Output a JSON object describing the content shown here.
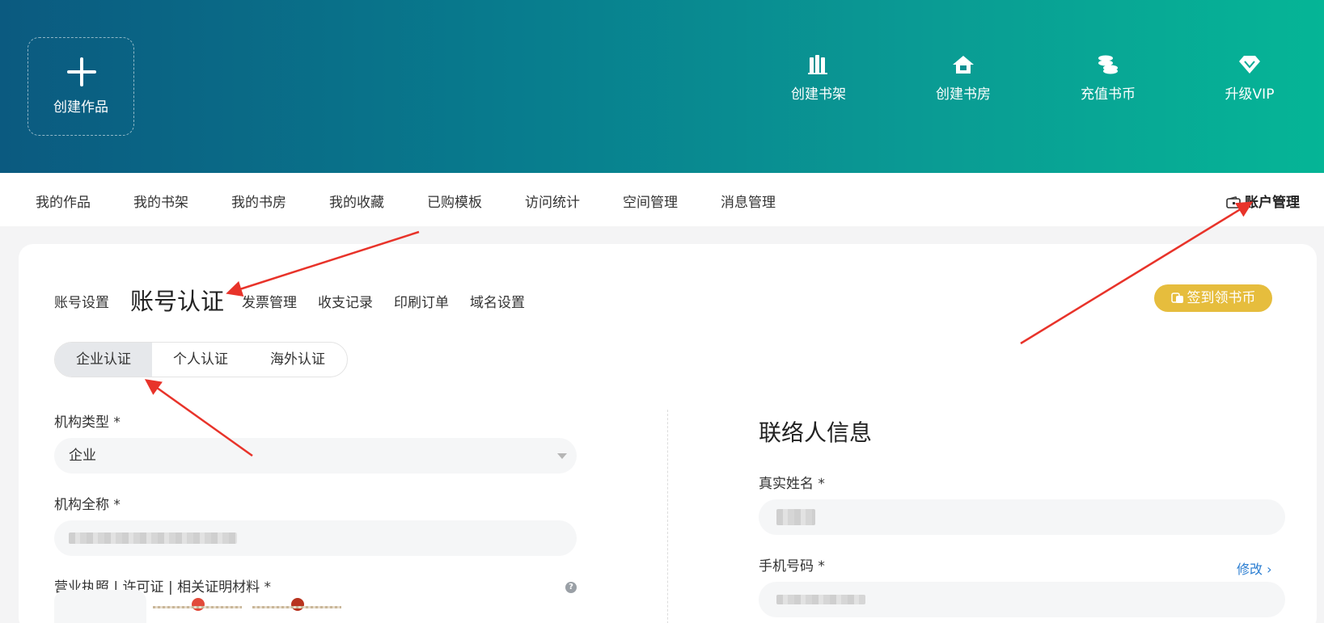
{
  "header": {
    "create_work": "创建作品",
    "actions": [
      {
        "label": "创建书架",
        "icon": "bookshelf-icon"
      },
      {
        "label": "创建书房",
        "icon": "house-icon"
      },
      {
        "label": "充值书币",
        "icon": "coins-icon"
      },
      {
        "label": "升级VIP",
        "icon": "diamond-icon"
      }
    ]
  },
  "nav": {
    "items": [
      "我的作品",
      "我的书架",
      "我的书房",
      "我的收藏",
      "已购模板",
      "访问统计",
      "空间管理",
      "消息管理"
    ],
    "account": "账户管理"
  },
  "subtabs": {
    "items": [
      "账号设置",
      "账号认证",
      "发票管理",
      "收支记录",
      "印刷订单",
      "域名设置"
    ],
    "active": "账号认证"
  },
  "checkin": {
    "label": "签到领书币"
  },
  "cert_types": {
    "items": [
      "企业认证",
      "个人认证",
      "海外认证"
    ],
    "active": "企业认证"
  },
  "form": {
    "org_type_label": "机构类型 *",
    "org_type_value": "企业",
    "org_name_label": "机构全称 *",
    "license_label": "营业执照 | 许可证 | 相关证明材料 *"
  },
  "contact": {
    "title": "联络人信息",
    "name_label": "真实姓名 *",
    "phone_label": "手机号码 *",
    "edit_label": "修改 ›"
  },
  "colors": {
    "banner_start": "#0b5a80",
    "banner_end": "#05b596",
    "checkin_bg": "#e6bd3d",
    "link": "#2a7dd1",
    "annotation_arrow": "#e8332a"
  }
}
